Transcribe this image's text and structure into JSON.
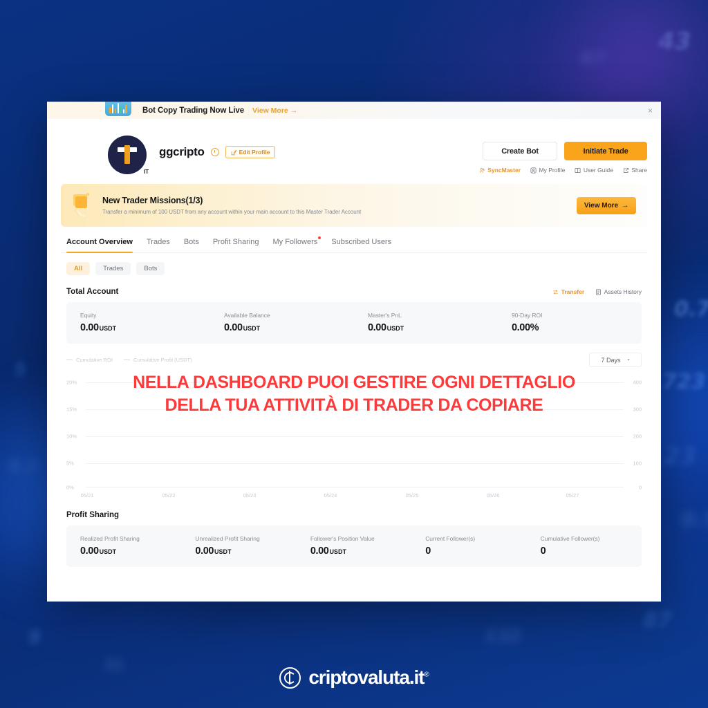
{
  "announcement": {
    "icon": "chart-bars-icon",
    "title": "Bot Copy Trading Now Live",
    "link_label": "View More",
    "link_arrow": "→",
    "close_icon": "×"
  },
  "profile": {
    "avatar_letter": "T",
    "avatar_badge": "IT",
    "username": "ggcripto",
    "clock_icon": "clock-icon",
    "edit_button": "Edit Profile",
    "edit_icon": "pencil-square-icon"
  },
  "header_actions": {
    "create_bot": "Create Bot",
    "initiate_trade": "Initiate Trade",
    "links": [
      {
        "label": "SyncMaster",
        "icon": "sync-master-icon",
        "accent": true
      },
      {
        "label": "My Profile",
        "icon": "profile-icon",
        "accent": false
      },
      {
        "label": "User Guide",
        "icon": "book-icon",
        "accent": false
      },
      {
        "label": "Share",
        "icon": "share-icon",
        "accent": false
      }
    ]
  },
  "mission": {
    "icon": "scroll-quest-icon",
    "title": "New Trader Missions(1/3)",
    "subtitle": "Transfer a minimum of 100 USDT from any account within your main account to this Master Trader Account",
    "button": "View More",
    "button_arrow": "→"
  },
  "tabs": [
    {
      "label": "Account Overview",
      "active": true,
      "dot": false
    },
    {
      "label": "Trades",
      "active": false,
      "dot": false
    },
    {
      "label": "Bots",
      "active": false,
      "dot": false
    },
    {
      "label": "Profit Sharing",
      "active": false,
      "dot": false
    },
    {
      "label": "My Followers",
      "active": false,
      "dot": true
    },
    {
      "label": "Subscribed Users",
      "active": false,
      "dot": false
    }
  ],
  "filter_chips": [
    {
      "label": "All",
      "active": true
    },
    {
      "label": "Trades",
      "active": false
    },
    {
      "label": "Bots",
      "active": false
    }
  ],
  "total_account": {
    "title": "Total Account",
    "transfer_label": "Transfer",
    "transfer_icon": "transfer-arrows-icon",
    "assets_history_label": "Assets History",
    "assets_history_icon": "document-icon",
    "stats": [
      {
        "label": "Equity",
        "value": "0.00",
        "unit": "USDT"
      },
      {
        "label": "Available Balance",
        "value": "0.00",
        "unit": "USDT"
      },
      {
        "label": "Master's PnL",
        "value": "0.00",
        "unit": "USDT"
      },
      {
        "label": "90-Day ROI",
        "value": "0.00%",
        "unit": ""
      }
    ]
  },
  "chart_data": {
    "type": "line",
    "title": "",
    "legend": [
      "Cumulative ROI",
      "Cumulative Profit (USDT)"
    ],
    "legend_position": "top-left",
    "range_selector": "7 Days",
    "range_chevron": "▾",
    "x": [
      "05/21",
      "05/22",
      "05/23",
      "05/24",
      "05/25",
      "05/26",
      "05/27"
    ],
    "xlabel": "",
    "ylabel_left": "Cumulative ROI",
    "ylabel_right": "Cumulative Profit (USDT)",
    "yticks_left": [
      "20%",
      "15%",
      "10%",
      "5%",
      "0%"
    ],
    "yticks_right": [
      "400",
      "300",
      "200",
      "100",
      "0"
    ],
    "ylim_left": [
      0,
      20
    ],
    "ylim_right": [
      0,
      400
    ],
    "grid": true,
    "series": [
      {
        "name": "Cumulative ROI",
        "values": [
          0,
          0,
          0,
          0,
          0,
          0,
          0
        ]
      },
      {
        "name": "Cumulative Profit (USDT)",
        "values": [
          0,
          0,
          0,
          0,
          0,
          0,
          0
        ]
      }
    ]
  },
  "profit_sharing": {
    "title": "Profit Sharing",
    "stats": [
      {
        "label": "Realized Profit Sharing",
        "value": "0.00",
        "unit": "USDT"
      },
      {
        "label": "Unrealized Profit Sharing",
        "value": "0.00",
        "unit": "USDT"
      },
      {
        "label": "Follower's Position Value",
        "value": "0.00",
        "unit": "USDT"
      },
      {
        "label": "Current Follower(s)",
        "value": "0",
        "unit": ""
      },
      {
        "label": "Cumulative Follower(s)",
        "value": "0",
        "unit": ""
      }
    ]
  },
  "overlay": {
    "line1": "NELLA DASHBOARD PUOI GESTIRE OGNI DETTAGLIO",
    "line2": "DELLA TUA ATTIVITÀ DI TRADER DA COPIARE",
    "color": "#fb3b3b"
  },
  "brand": {
    "name": "criptovaluta.it",
    "registered": "®",
    "icon": "coin-c-icon"
  },
  "colors": {
    "accent_orange": "#f9a41b",
    "accent_amber": "#e8942a",
    "background_blue": "#0a2c74",
    "overlay_red": "#fb3b3b",
    "notification_red": "#f5453d"
  },
  "bg_numbers": [
    "0.7",
    "723",
    "43",
    "87",
    "132",
    "23",
    "5",
    "9",
    "0.5",
    "31",
    "0.2"
  ]
}
